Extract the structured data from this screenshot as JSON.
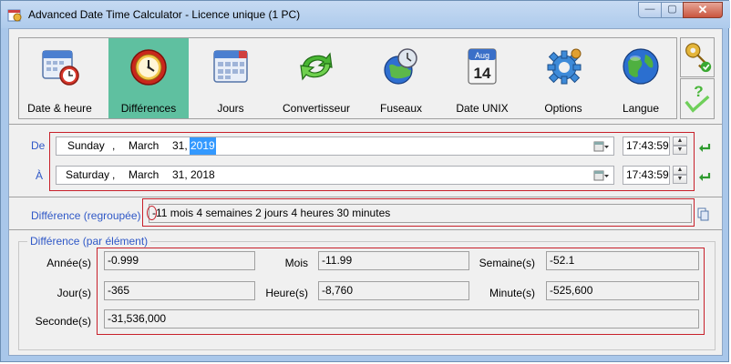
{
  "window": {
    "title": "Advanced Date Time Calculator - Licence unique (1 PC)",
    "controls": {
      "minimize": "—",
      "maximize": "▢",
      "close": "✕"
    }
  },
  "toolbar": {
    "active_index": 1,
    "items": [
      {
        "label": "Date & heure",
        "icon": "calendar-clock-icon"
      },
      {
        "label": "Différences",
        "icon": "clock-icon"
      },
      {
        "label": "Jours",
        "icon": "calendar-grid-icon"
      },
      {
        "label": "Convertisseur",
        "icon": "convert-arrows-icon"
      },
      {
        "label": "Fuseaux",
        "icon": "globe-clock-icon"
      },
      {
        "label": "Date UNIX",
        "icon": "unix-calendar-icon"
      },
      {
        "label": "Options",
        "icon": "gears-icon"
      },
      {
        "label": "Langue",
        "icon": "globe-icon"
      }
    ],
    "unix_icon_text": {
      "month": "Aug",
      "day": "14"
    },
    "side_buttons": [
      {
        "icon": "key-check-icon"
      },
      {
        "icon": "help-check-icon"
      }
    ]
  },
  "from": {
    "label": "De",
    "weekday": "Sunday",
    "sep": ",",
    "month": "March",
    "day": "31,",
    "year": "2019",
    "time": "17:43:59"
  },
  "to": {
    "label": "À",
    "weekday": "Saturday",
    "sep": ",",
    "month": "March",
    "day": "31,",
    "year": "2018",
    "time": "17:43:59"
  },
  "difference": {
    "label": "Différence (regroupée)",
    "value": "-11 mois 4 semaines 2 jours 4 heures 30 minutes"
  },
  "elements": {
    "title": "Différence (par élément)",
    "years_label": "Année(s)",
    "years": "-0.999",
    "months_label": "Mois",
    "months": "-11.99",
    "weeks_label": "Semaine(s)",
    "weeks": "-52.1",
    "days_label": "Jour(s)",
    "days": "-365",
    "hours_label": "Heure(s)",
    "hours": "-8,760",
    "minutes_label": "Minute(s)",
    "minutes": "-525,600",
    "seconds_label": "Seconde(s)",
    "seconds": "-31,536,000"
  },
  "colors": {
    "accent": "#5fc0a0",
    "label_blue": "#2f58c7",
    "highlight_red": "#c8202a",
    "selection": "#3399ff"
  }
}
